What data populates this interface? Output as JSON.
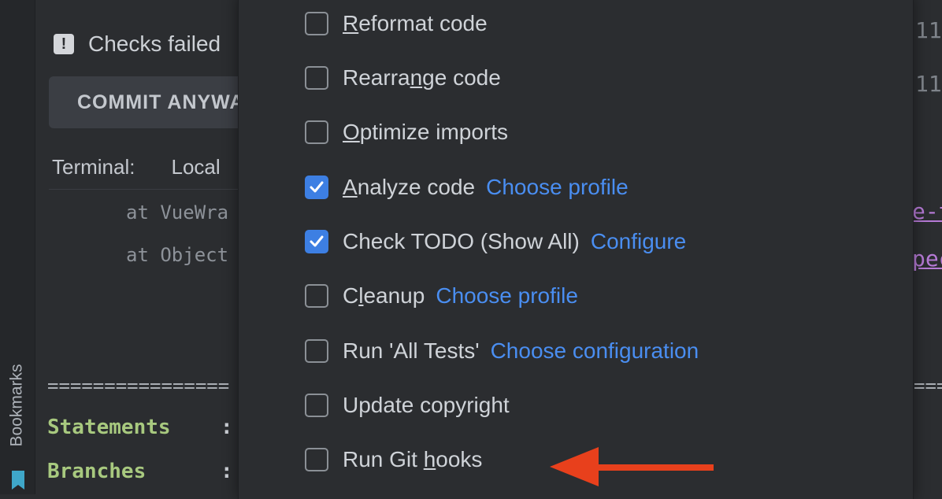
{
  "sidebar": {
    "bookmarks_label": "Bookmarks"
  },
  "commit_panel": {
    "checks_failed": "Checks failed",
    "commit_anyway": "COMMIT ANYWAY"
  },
  "terminal": {
    "label": "Terminal:",
    "tab": "Local",
    "stack_lines": [
      "at VueWra",
      "at Object"
    ],
    "separator": "================",
    "coverage": [
      {
        "label": "Statements",
        "colon": ":"
      },
      {
        "label": "Branches",
        "colon": ":"
      }
    ]
  },
  "editor_right": {
    "numbers": [
      "11",
      "11"
    ],
    "links": [
      "e-t",
      "pec"
    ],
    "separator": "==="
  },
  "commit_options": [
    {
      "pre": "",
      "mnemonic": "R",
      "post": "eformat code",
      "checked": false,
      "link": ""
    },
    {
      "pre": "Rearra",
      "mnemonic": "n",
      "post": "ge code",
      "checked": false,
      "link": ""
    },
    {
      "pre": "",
      "mnemonic": "O",
      "post": "ptimize imports",
      "checked": false,
      "link": ""
    },
    {
      "pre": "",
      "mnemonic": "A",
      "post": "nalyze code",
      "checked": true,
      "link": "Choose profile"
    },
    {
      "pre": "Check TODO (Show All)",
      "mnemonic": "",
      "post": "",
      "checked": true,
      "link": "Configure"
    },
    {
      "pre": "C",
      "mnemonic": "l",
      "post": "eanup",
      "checked": false,
      "link": "Choose profile"
    },
    {
      "pre": "Run 'All Tests'",
      "mnemonic": "",
      "post": "",
      "checked": false,
      "link": "Choose configuration"
    },
    {
      "pre": "Update copyright",
      "mnemonic": "",
      "post": "",
      "checked": false,
      "link": ""
    },
    {
      "pre": "Run Git ",
      "mnemonic": "h",
      "post": "ooks",
      "checked": false,
      "link": ""
    }
  ],
  "colors": {
    "accent_blue": "#3d7fe3",
    "link_blue": "#4a8ef1",
    "arrow_red": "#e8401c",
    "coverage_green": "#a8c97f"
  },
  "icons": {
    "warning": "exclamation-square-icon",
    "bookmark": "bookmark-icon",
    "check": "checkmark-icon",
    "pointer": "red-arrow-icon"
  }
}
